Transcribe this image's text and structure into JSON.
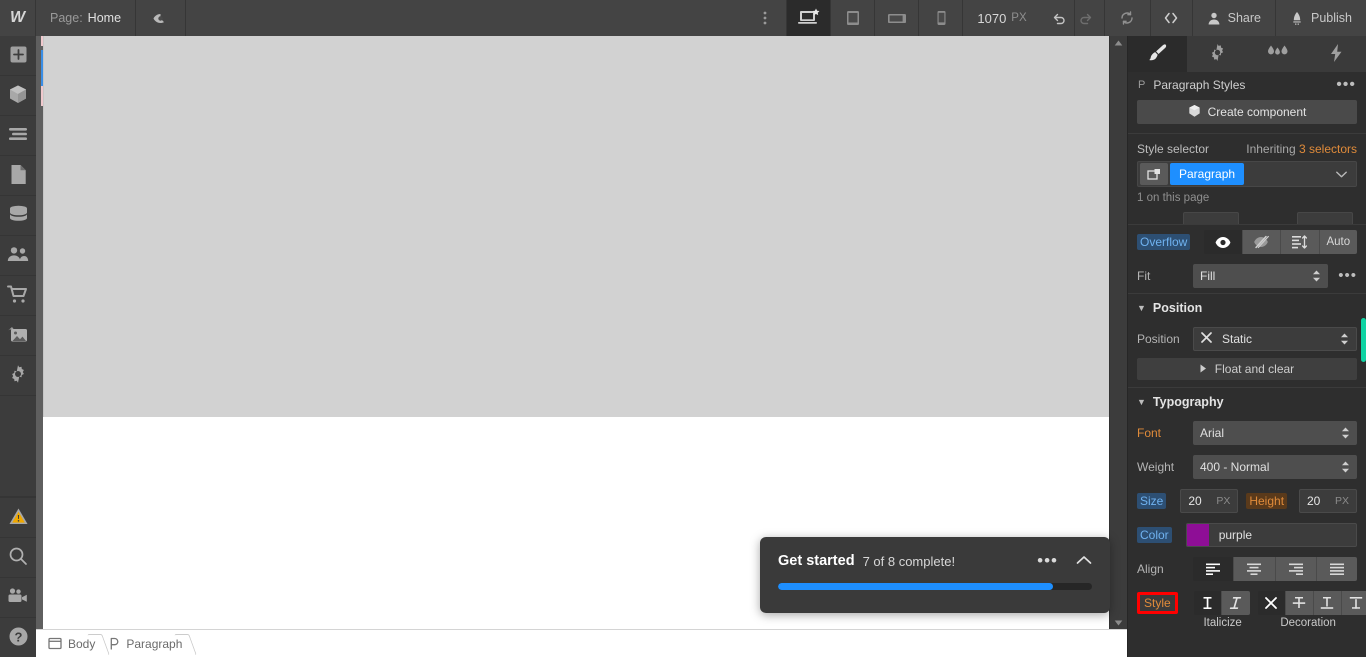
{
  "topbar": {
    "logo": "W",
    "page_label": "Page:",
    "page_value": "Home",
    "preview_icon": "eye-icon",
    "kebab_icon": "more-vertical-icon",
    "viewports": [
      {
        "name": "desktop",
        "icon": "desktop-icon",
        "active": true
      },
      {
        "name": "tablet",
        "icon": "tablet-icon",
        "active": false
      },
      {
        "name": "mobile-landscape",
        "icon": "mobile-landscape-icon",
        "active": false
      },
      {
        "name": "mobile-portrait",
        "icon": "mobile-portrait-icon",
        "active": false
      }
    ],
    "viewport_width": "1070",
    "viewport_unit": "PX",
    "undo_icon": "undo-icon",
    "redo_icon": "redo-icon",
    "sync_icon": "sync-icon",
    "code_icon": "code-icon",
    "share_label": "Share",
    "publish_label": "Publish"
  },
  "left_rail": {
    "items": [
      {
        "name": "add-panel",
        "icon": "plus-icon"
      },
      {
        "name": "components-panel",
        "icon": "cube-icon"
      },
      {
        "name": "navigator-panel",
        "icon": "layers-icon"
      },
      {
        "name": "pages-panel",
        "icon": "page-icon"
      },
      {
        "name": "cms-panel",
        "icon": "database-icon"
      },
      {
        "name": "users-panel",
        "icon": "users-icon"
      },
      {
        "name": "ecommerce-panel",
        "icon": "cart-icon"
      },
      {
        "name": "assets-panel",
        "icon": "images-icon"
      },
      {
        "name": "settings-panel",
        "icon": "gear-icon"
      }
    ],
    "bottom_items": [
      {
        "name": "audit-panel",
        "icon": "warning-triangle-icon"
      },
      {
        "name": "search",
        "icon": "search-icon"
      },
      {
        "name": "video-tutorials",
        "icon": "video-camera-icon"
      },
      {
        "name": "help",
        "icon": "question-mark-icon"
      }
    ]
  },
  "get_started": {
    "title": "Get started",
    "subtitle": "7 of 8 complete!",
    "dots_icon": "more-horizontal-icon",
    "collapse_icon": "chevron-up-icon",
    "progress_percent": 87.5,
    "progress_color": "#1e8fff"
  },
  "breadcrumb": {
    "items": [
      {
        "label": "Body",
        "icon": "body-window-icon"
      },
      {
        "label": "Paragraph",
        "icon": "paragraph-p-icon"
      }
    ]
  },
  "right_panel": {
    "tabs": [
      {
        "name": "style",
        "icon": "paintbrush-icon",
        "active": true
      },
      {
        "name": "settings",
        "icon": "gear-icon",
        "active": false
      },
      {
        "name": "interactions",
        "icon": "interactions-icon",
        "active": false
      },
      {
        "name": "effects",
        "icon": "lightning-bolt-icon",
        "active": false
      }
    ],
    "header": {
      "tag": "P",
      "title": "Paragraph Styles",
      "dots": "•••"
    },
    "create_component": {
      "label": "Create component",
      "icon": "cube-icon"
    },
    "style_selector": {
      "label": "Style selector",
      "inheriting_label": "Inheriting",
      "inheriting_count": "3 selectors",
      "selector_icon": "combo-class-icon",
      "chip": "Paragraph",
      "caret_icon": "chevron-down-icon",
      "on_page": "1 on this page"
    },
    "overflow": {
      "label": "Overflow",
      "options": [
        {
          "name": "visible",
          "icon": "eye-icon",
          "active": true
        },
        {
          "name": "hidden",
          "icon": "eye-slash-icon",
          "active": false
        },
        {
          "name": "scroll",
          "icon": "scroll-icon",
          "active": false
        },
        {
          "name": "auto",
          "label": "Auto",
          "active": false
        }
      ]
    },
    "fit": {
      "label": "Fit",
      "value": "Fill",
      "dots": "•••"
    },
    "position_section": {
      "title": "Position",
      "position_label": "Position",
      "position_value": "Static",
      "position_clear_icon": "x-icon",
      "float_and_clear": "Float and clear",
      "float_arrow_icon": "triangle-right-icon"
    },
    "typography_section": {
      "title": "Typography",
      "font_label": "Font",
      "font_value": "Arial",
      "weight_label": "Weight",
      "weight_value": "400 - Normal",
      "size_label": "Size",
      "size_value": "20",
      "size_unit": "PX",
      "height_label": "Height",
      "height_value": "20",
      "height_unit": "PX",
      "color_label": "Color",
      "color_value": "purple",
      "color_hex": "#8e0e96",
      "align_label": "Align",
      "align_options": [
        {
          "name": "align-left",
          "icon": "align-left-icon",
          "active": true
        },
        {
          "name": "align-center",
          "icon": "align-center-icon",
          "active": false
        },
        {
          "name": "align-right",
          "icon": "align-right-icon",
          "active": false
        },
        {
          "name": "align-justify",
          "icon": "align-justify-icon",
          "active": false
        }
      ],
      "style_label": "Style",
      "style_label_highlight_color": "#ff0000",
      "italicize_caption": "Italicize",
      "decoration_caption": "Decoration",
      "italicize_options": [
        {
          "name": "upright",
          "glyph": "I",
          "active": true
        },
        {
          "name": "italic",
          "glyph": "I",
          "active": false
        }
      ],
      "decoration_options": [
        {
          "name": "none",
          "glyph": "×",
          "active": true
        },
        {
          "name": "strikethrough",
          "glyph": "T",
          "active": false
        },
        {
          "name": "underline",
          "glyph": "T",
          "active": false
        },
        {
          "name": "overline",
          "glyph": "T",
          "active": false
        }
      ]
    },
    "scroll_indicator_color": "#0fd3a3"
  }
}
